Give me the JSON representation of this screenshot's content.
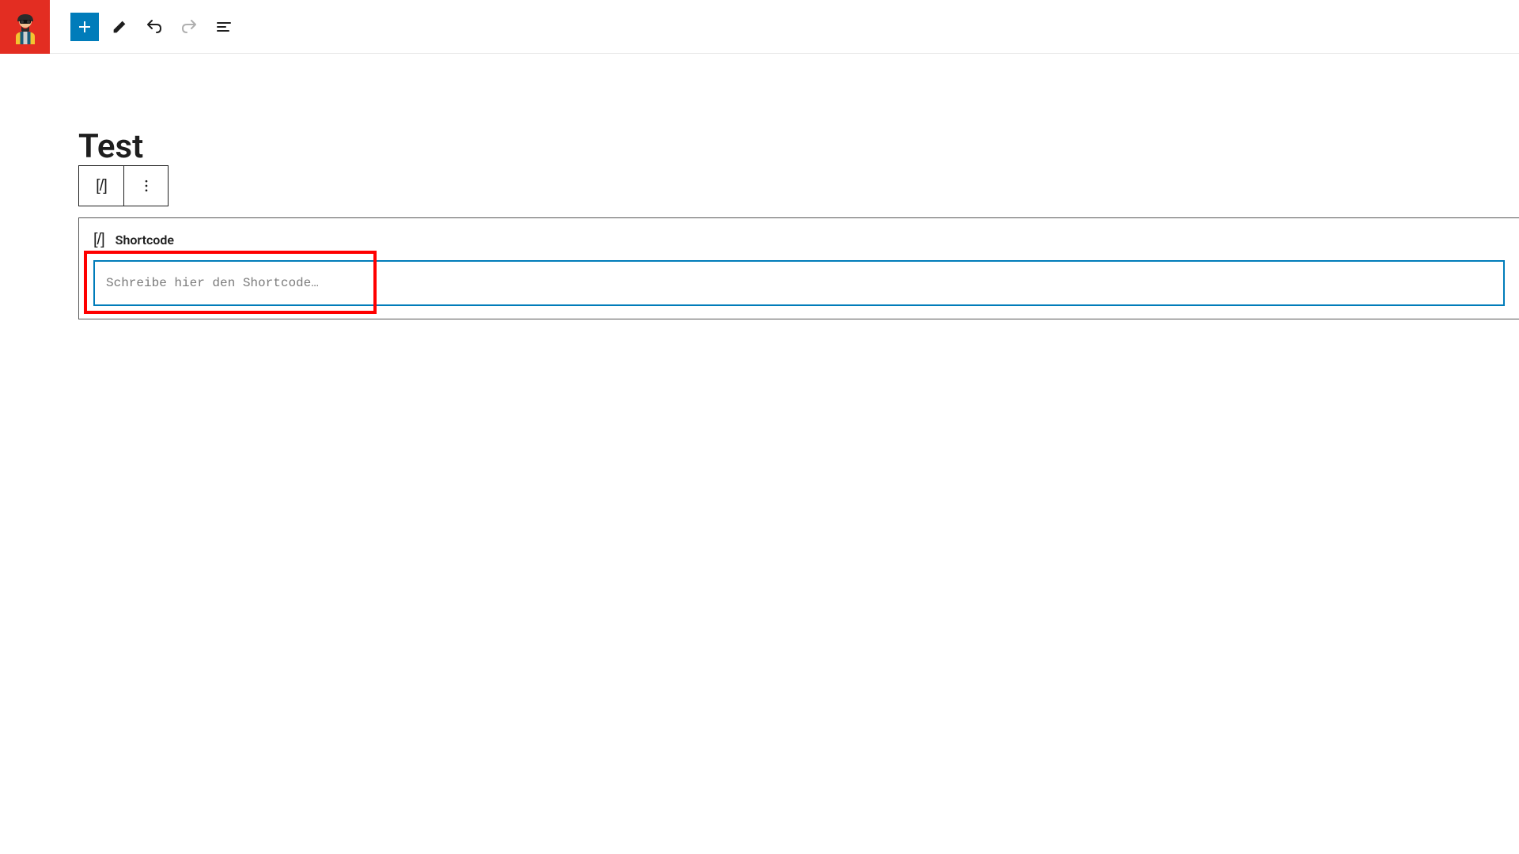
{
  "page": {
    "title": "Test"
  },
  "block": {
    "type_label": "Shortcode",
    "shortcode_symbol": "[/]",
    "input_value": "",
    "input_placeholder": "Schreibe hier den Shortcode…"
  },
  "colors": {
    "accent": "#007cba",
    "logo_bg": "#e32d22",
    "highlight": "#ff0000"
  }
}
